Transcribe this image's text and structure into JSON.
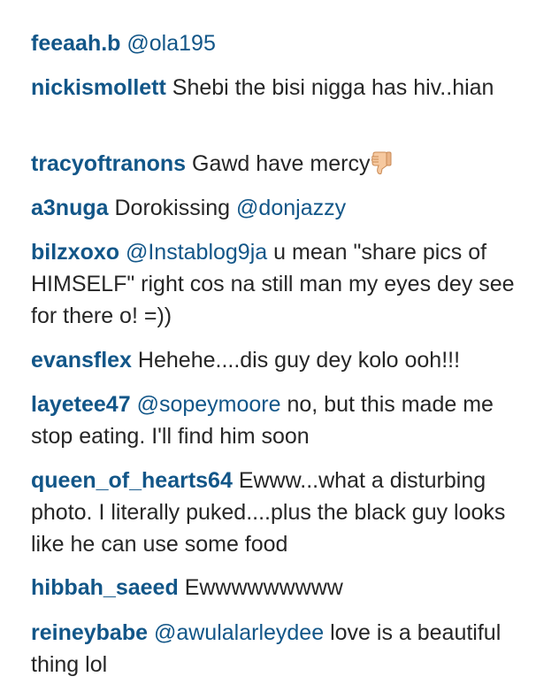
{
  "comments": [
    {
      "user": "feeaah.b",
      "mention": "@ola195",
      "text": ""
    },
    {
      "user": "nickismollett",
      "text": "Shebi the bisi nigga has hiv..hian"
    },
    {
      "user": "tracyoftranons",
      "text": "Gawd have mercy",
      "emoji": "thumbs-down-icon"
    },
    {
      "user": "a3nuga",
      "text": "Dorokissing",
      "mention": "@donjazzy"
    },
    {
      "user": "bilzxoxo",
      "mention": "@Instablog9ja",
      "text": "u mean \"share pics of HIMSELF\" right cos na still man my eyes dey see for there o! =))"
    },
    {
      "user": "evansflex",
      "text": "Hehehe....dis guy dey kolo ooh!!!"
    },
    {
      "user": "layetee47",
      "mention": "@sopeymoore",
      "text": "no, but this made me stop eating. I'll find him soon"
    },
    {
      "user": "queen_of_hearts64",
      "text": "Ewww...what a disturbing photo. I literally puked....plus the black guy looks like he can use some food"
    },
    {
      "user": "hibbah_saeed",
      "text": "Ewwwwwwwww"
    },
    {
      "user": "reineybabe",
      "mention": "@awulalarleydee",
      "text": "love is a beautiful thing lol"
    }
  ]
}
